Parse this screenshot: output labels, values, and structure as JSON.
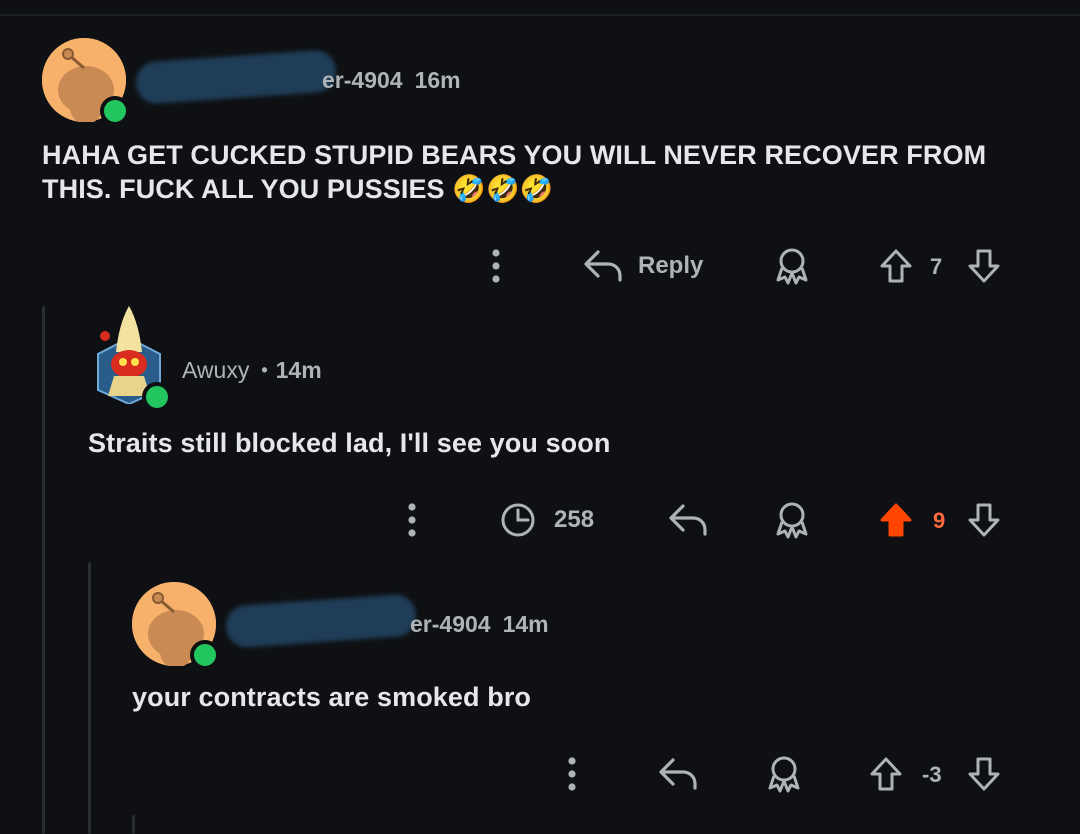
{
  "comments": [
    {
      "username_suffix": "er-4904",
      "time": "16m",
      "body": "HAHA GET CUCKED STUPID BEARS YOU WILL NEVER RECOVER FROM THIS. FUCK ALL YOU PUSSIES 🤣🤣🤣",
      "actions": {
        "more_icon": "more-vertical-icon",
        "reply_label": "Reply",
        "award_icon": "award-icon",
        "upvote_icon": "arrow-up-icon",
        "downvote_icon": "arrow-down-icon"
      },
      "score": "7"
    },
    {
      "username": "Awuxy",
      "separator": "•",
      "time": "14m",
      "body": "Straits still blocked lad, I'll see you soon",
      "actions": {
        "more_icon": "more-vertical-icon",
        "views_icon": "clock-icon",
        "views": "258",
        "reply_icon": "reply-icon",
        "award_icon": "award-icon",
        "upvote_icon": "arrow-up-filled-icon",
        "downvote_icon": "arrow-down-icon"
      },
      "score": "9"
    },
    {
      "username_suffix": "er-4904",
      "time": "14m",
      "body": "your contracts are smoked bro",
      "actions": {
        "more_icon": "more-vertical-icon",
        "reply_icon": "reply-icon",
        "award_icon": "award-icon",
        "upvote_icon": "arrow-up-icon",
        "downvote_icon": "arrow-down-icon"
      },
      "score": "-3"
    }
  ],
  "colors": {
    "background": "#0e1013",
    "text": "#e5e7ea",
    "muted": "#aeb3b8",
    "upvote_active": "#ff4500",
    "online": "#22c55e",
    "avatar_bg": "#f7b16b"
  }
}
